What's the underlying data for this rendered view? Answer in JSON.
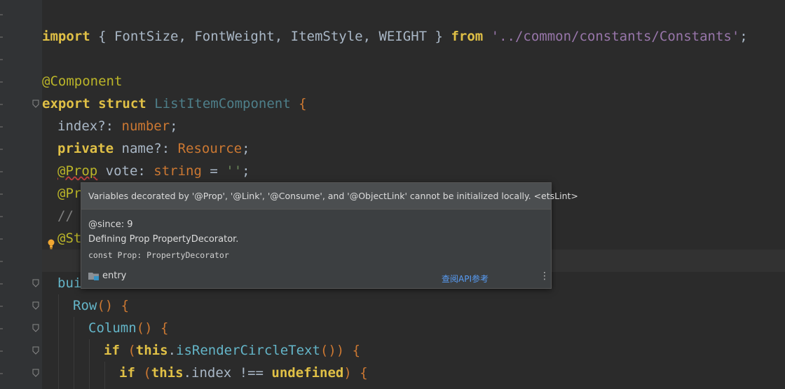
{
  "editor": {
    "lines": [
      {
        "id": "l1"
      },
      {
        "id": "l3"
      }
    ]
  },
  "code": {
    "import_kw": "import",
    "import_names": "{ FontSize, FontWeight, ItemStyle, WEIGHT }",
    "from_kw": "from",
    "import_path": "'../common/constants/Constants'",
    "semicolon": ";",
    "component_annot": "@Component",
    "export_kw": "export",
    "struct_kw": "struct",
    "struct_name": "ListItemComponent",
    "open_brace": "{",
    "index_field": "index?: ",
    "number_type": "number",
    "private_kw": "private",
    "name_field": " name?: ",
    "resource_type": "Resource",
    "prop_annot": "@Prop",
    "vote_field": " vote: ",
    "string_type": "string",
    "vote_assign": " = ",
    "vote_value": "''",
    "prop_annot2": "@Pr",
    "comment_line": "// ",
    "state_annot": "@St",
    "build_fn": "bui",
    "row_fn": "Row",
    "row_rest": "() {",
    "column_fn": "Column",
    "column_rest": "() {",
    "if_kw": "if",
    "this_kw": "this",
    "render_call": "isRenderCircleText",
    "if1_rest": "()) {",
    "if2_rest_a": ".index !== ",
    "undefined_kw": "undefined",
    "if2_rest_b": ") {"
  },
  "tooltip": {
    "header": "Variables decorated by '@Prop', '@Link', '@Consume', and '@ObjectLink' cannot be initialized locally. <etsLint>",
    "since": "@since: 9",
    "definition": "Defining Prop PropertyDecorator.",
    "signature": "const Prop: PropertyDecorator",
    "module": "entry",
    "api_link": "查阅API参考",
    "more": "⋮"
  },
  "colors": {
    "background": "#2b2b2b",
    "keyword": "#cc7832",
    "string": "#6a8759",
    "annotation": "#bbb529",
    "link": "#589df6"
  }
}
